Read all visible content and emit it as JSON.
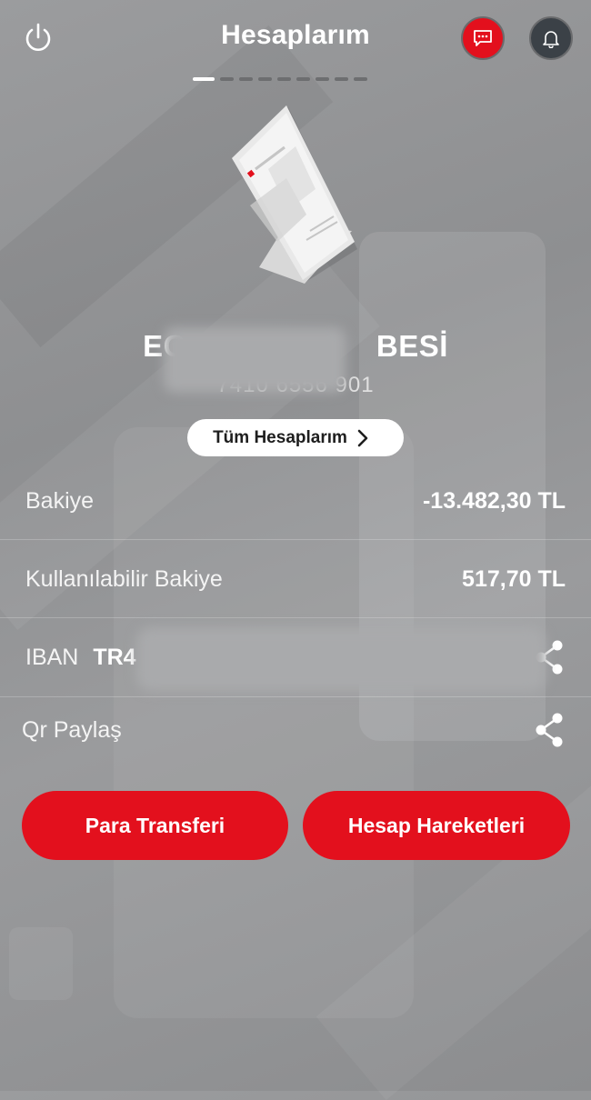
{
  "header": {
    "title": "Hesaplarım",
    "icons": {
      "power": "power-icon",
      "chat": "chat-icon",
      "bell": "bell-icon"
    }
  },
  "pager": {
    "total": 9,
    "active_index": 0
  },
  "account": {
    "name_visible": "EC",
    "name_visible_end": "BESİ",
    "number_visible_start": "7410",
    "number_visible_mid": "6556",
    "number_visible_end": "901",
    "all_accounts_label": "Tüm Hesaplarım"
  },
  "rows": {
    "balance": {
      "label": "Bakiye",
      "value": "-13.482,30 TL"
    },
    "available": {
      "label": "Kullanılabilir Bakiye",
      "value": "517,70 TL"
    },
    "iban": {
      "label": "IBAN",
      "value": "TR4"
    },
    "qr": {
      "label": "Qr Paylaş"
    }
  },
  "actions": {
    "transfer": "Para Transferi",
    "history": "Hesap Hareketleri"
  },
  "colors": {
    "accent": "#e3101d",
    "bell_bg": "#3b4147",
    "background": "#9a9b9d"
  }
}
